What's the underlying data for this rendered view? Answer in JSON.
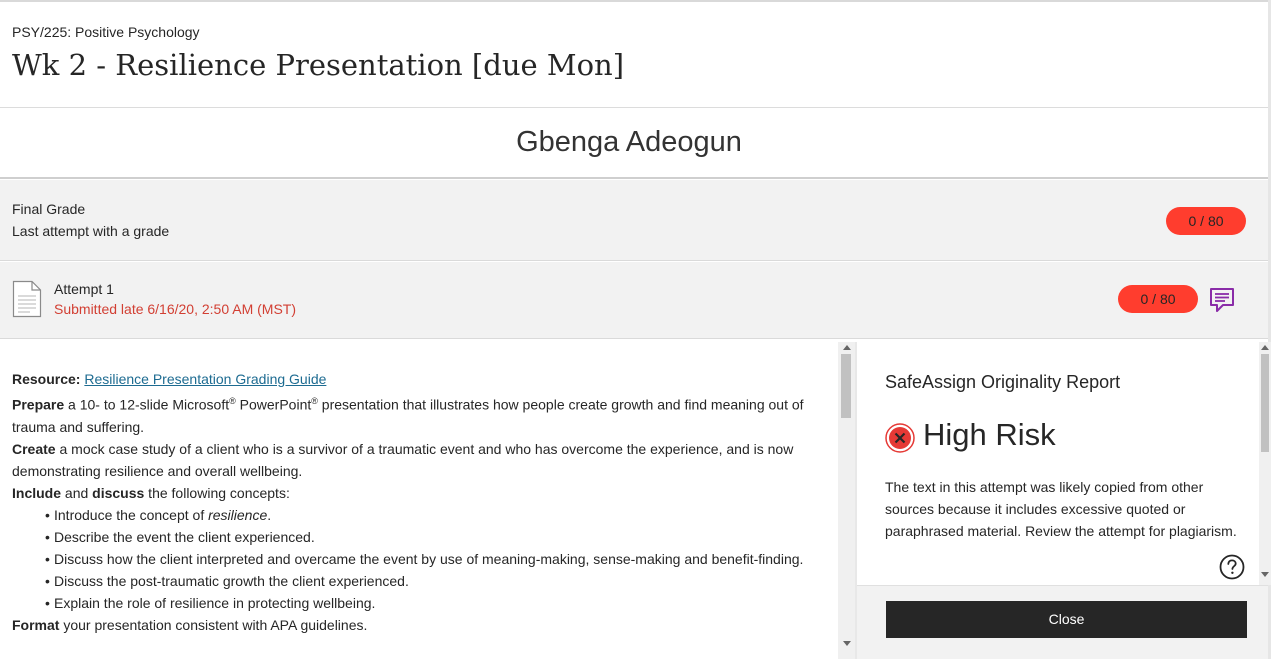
{
  "header": {
    "course": "PSY/225: Positive Psychology",
    "title": "Wk 2 - Resilience Presentation [due Mon]"
  },
  "student": {
    "name": "Gbenga Adeogun"
  },
  "final_grade": {
    "label": "Final Grade",
    "sublabel": "Last attempt with a grade",
    "score": "0 / 80",
    "badge_color": "#ff3d2e"
  },
  "attempt": {
    "label": "Attempt 1",
    "status": "Submitted late 6/16/20, 2:50 AM (MST)",
    "score": "0 / 80",
    "status_color": "#d23f33",
    "icons": [
      "document-icon",
      "feedback-icon"
    ]
  },
  "instructions": {
    "resource_label": "Resource:",
    "resource_link": "Resilience Presentation Grading Guide",
    "prepare_bold": "Prepare",
    "prepare_text_1": " a 10- to 12-slide Microsoft",
    "reg": "®",
    "prepare_text_2": " PowerPoint",
    "prepare_text_3": " presentation that illustrates how people create growth and find meaning out of trauma and suffering.",
    "create_bold": "Create",
    "create_text": " a mock case study of a client who is a survivor of a traumatic event and who has overcome the experience, and is now demonstrating resilience and overall wellbeing.",
    "include_bold": "Include",
    "and_text": " and ",
    "discuss_bold": "discuss",
    "include_text": " the following concepts:",
    "bullet_1_text": "Introduce the concept of ",
    "bullet_1_italic": "resilience",
    "bullet_1_end": ".",
    "bullets": [
      "Describe the event the client experienced.",
      "Discuss how the client interpreted and overcame the event by use of meaning-making, sense-making and benefit-finding.",
      "Discuss the post-traumatic growth the client experienced.",
      "Explain the role of resilience in protecting wellbeing."
    ],
    "format_bold": "Format",
    "format_text": " your presentation consistent with APA guidelines."
  },
  "safeassign": {
    "title": "SafeAssign Originality Report",
    "risk": "High Risk",
    "risk_color": "#e53935",
    "description": "The text in this attempt was likely copied from other sources because it includes excessive quoted or paraphrased material. Review the attempt for plagiarism.",
    "close_label": "Close",
    "icons": [
      "high-risk-icon",
      "help-icon"
    ]
  }
}
